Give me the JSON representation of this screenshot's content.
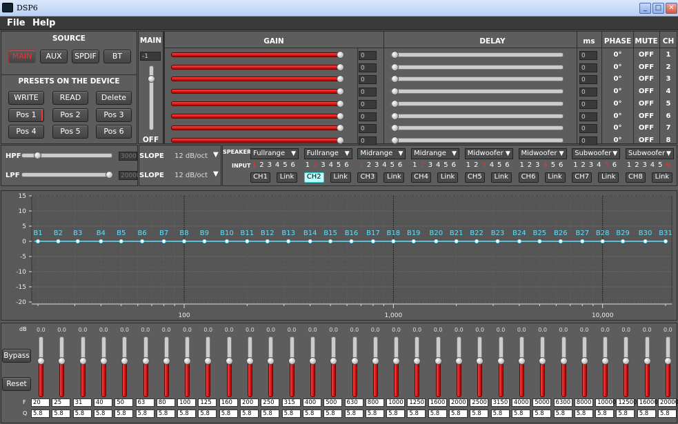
{
  "window": {
    "title": "DSP6",
    "min_icon": "minimize-icon",
    "max_icon": "maximize-icon",
    "close_icon": "close-icon"
  },
  "menu": [
    "File",
    "Help"
  ],
  "source": {
    "title": "SOURCE",
    "buttons": [
      "MAIN",
      "AUX",
      "SPDIF",
      "BT"
    ],
    "active": "MAIN"
  },
  "presets": {
    "title": "PRESETS ON THE DEVICE",
    "actions": [
      "WRITE",
      "READ",
      "Delete"
    ],
    "positions": [
      "Pos 1",
      "Pos 2",
      "Pos 3",
      "Pos 4",
      "Pos 5",
      "Pos 6"
    ],
    "active": "Pos 1"
  },
  "main": {
    "title": "MAIN",
    "value": "-1",
    "off_label": "OFF",
    "level": 0.8
  },
  "filters": {
    "hpf_label": "HPF",
    "hpf_value": "3000",
    "lpf_label": "LPF",
    "lpf_value": "20000",
    "slope_label": "SLOPE",
    "hpf_slope": "12 dB/oct",
    "lpf_slope": "12 dB/oct"
  },
  "headers": {
    "gain": "GAIN",
    "delay": "DELAY",
    "ms": "ms",
    "phase": "PHASE",
    "mute": "MUTE",
    "ch": "CH"
  },
  "channels": [
    {
      "gain": "0",
      "delay": "0",
      "phase": "0°",
      "mute": "OFF",
      "ch": "1"
    },
    {
      "gain": "0",
      "delay": "0",
      "phase": "0°",
      "mute": "OFF",
      "ch": "2"
    },
    {
      "gain": "0",
      "delay": "0",
      "phase": "0°",
      "mute": "OFF",
      "ch": "3"
    },
    {
      "gain": "0",
      "delay": "0",
      "phase": "0°",
      "mute": "OFF",
      "ch": "4"
    },
    {
      "gain": "0",
      "delay": "0",
      "phase": "0°",
      "mute": "OFF",
      "ch": "5"
    },
    {
      "gain": "0",
      "delay": "0",
      "phase": "0°",
      "mute": "OFF",
      "ch": "6"
    },
    {
      "gain": "0",
      "delay": "0",
      "phase": "0°",
      "mute": "OFF",
      "ch": "7"
    },
    {
      "gain": "0",
      "delay": "0",
      "phase": "0°",
      "mute": "OFF",
      "ch": "8"
    }
  ],
  "routing": {
    "speaker_label": "SPEAKER",
    "input_label": "INPUT",
    "link_label": "Link",
    "input_numbers": [
      "1",
      "2",
      "3",
      "4",
      "5",
      "6"
    ],
    "outputs": [
      {
        "speaker": "Fullrange",
        "ch": "CH1",
        "red": [
          "1"
        ],
        "active": false
      },
      {
        "speaker": "Fullrange",
        "ch": "CH2",
        "red": [
          "2"
        ],
        "active": true
      },
      {
        "speaker": "Midrange",
        "ch": "CH3",
        "red": [
          "1"
        ],
        "active": false
      },
      {
        "speaker": "Midrange",
        "ch": "CH4",
        "red": [
          "2"
        ],
        "active": false
      },
      {
        "speaker": "Midwoofer",
        "ch": "CH5",
        "red": [
          "3"
        ],
        "active": false
      },
      {
        "speaker": "Midwoofer",
        "ch": "CH6",
        "red": [
          "4"
        ],
        "active": false
      },
      {
        "speaker": "Subwoofer",
        "ch": "CH7",
        "red": [
          "5"
        ],
        "active": false
      },
      {
        "speaker": "Subwoofer",
        "ch": "CH8",
        "red": [
          "6"
        ],
        "active": false
      }
    ]
  },
  "graph": {
    "y_ticks": [
      "15",
      "10",
      "5",
      "0",
      "-5",
      "-10",
      "-15",
      "-20"
    ],
    "x_ticks": [
      "100",
      "1,000",
      "10,000"
    ],
    "bands": [
      "B1",
      "B2",
      "B3",
      "B4",
      "B5",
      "B6",
      "B7",
      "B8",
      "B9",
      "B10",
      "B11",
      "B12",
      "B13",
      "B14",
      "B15",
      "B16",
      "B17",
      "B18",
      "B19",
      "B20",
      "B21",
      "B22",
      "B23",
      "B24",
      "B25",
      "B26",
      "B27",
      "B28",
      "B29",
      "B30",
      "B31"
    ]
  },
  "eq": {
    "db_label": "dB",
    "f_label": "F",
    "q_label": "Q",
    "bypass": "Bypass",
    "reset": "Reset",
    "gains": [
      "0.0",
      "0.0",
      "0.0",
      "0.0",
      "0.0",
      "0.0",
      "0.0",
      "0.0",
      "0.0",
      "0.0",
      "0.0",
      "0.0",
      "0.0",
      "0.0",
      "0.0",
      "0.0",
      "0.0",
      "0.0",
      "0.0",
      "0.0",
      "0.0",
      "0.0",
      "0.0",
      "0.0",
      "0.0",
      "0.0",
      "0.0",
      "0.0",
      "0.0",
      "0.0",
      "0.0"
    ],
    "freqs": [
      "20",
      "25",
      "31",
      "40",
      "50",
      "63",
      "80",
      "100",
      "125",
      "160",
      "200",
      "250",
      "315",
      "400",
      "500",
      "630",
      "800",
      "1000",
      "1250",
      "1600",
      "2000",
      "2500",
      "3150",
      "4000",
      "5000",
      "6300",
      "8000",
      "10000",
      "12500",
      "16000",
      "20000"
    ],
    "qs": [
      "5.8",
      "5.8",
      "5.8",
      "5.8",
      "5.8",
      "5.8",
      "5.8",
      "5.8",
      "5.8",
      "5.8",
      "5.8",
      "5.8",
      "5.8",
      "5.8",
      "5.8",
      "5.8",
      "5.8",
      "5.8",
      "5.8",
      "5.8",
      "5.8",
      "5.8",
      "5.8",
      "5.8",
      "5.8",
      "5.8",
      "5.8",
      "5.8",
      "5.8",
      "5.8",
      "5.8"
    ]
  },
  "colors": {
    "accent_red": "#ff2a2a",
    "curve": "#5fe0ff",
    "active_channel": "#bbffff"
  }
}
